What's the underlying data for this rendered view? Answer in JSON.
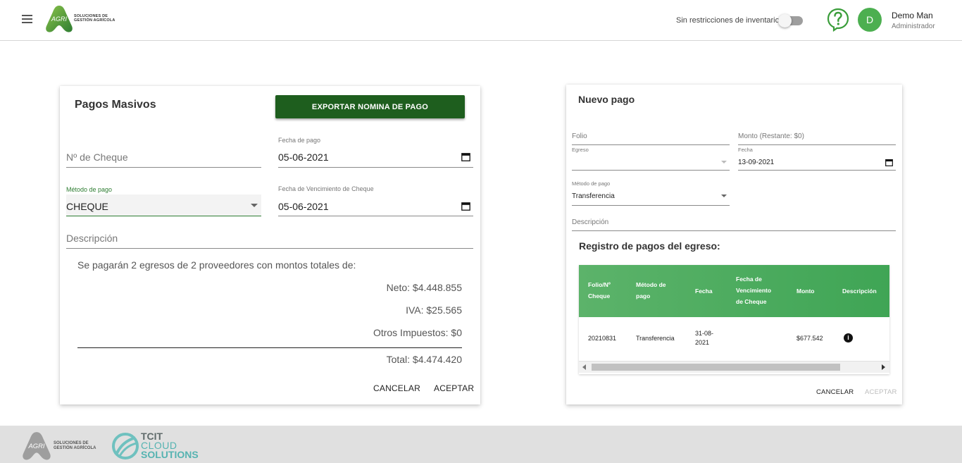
{
  "header": {
    "logo_text": "SOLUCIONES DE GESTIÓN AGRÍCOLA",
    "logo_mark": "AGRI",
    "inventory_label": "Sin restricciones de inventario",
    "user": {
      "initial": "D",
      "name": "Demo Man",
      "role": "Administrador"
    }
  },
  "left_card": {
    "title": "Pagos Masivos",
    "export_button": "EXPORTAR NOMINA DE PAGO",
    "cheque_placeholder": "Nº de Cheque",
    "fecha_pago_label": "Fecha de pago",
    "fecha_pago_value": "05-06-2021",
    "metodo_label": "Método de pago",
    "metodo_value": "CHEQUE",
    "vencimiento_label": "Fecha de Vencimiento de Cheque",
    "vencimiento_value": "05-06-2021",
    "descripcion_placeholder": "Descripción",
    "summary_text": "Se pagarán 2 egresos de 2 proveedores con montos totales de:",
    "neto": "Neto: $4.448.855",
    "iva": "IVA: $25.565",
    "otros": "Otros Impuestos: $0",
    "total": "Total: $4.474.420",
    "cancel": "CANCELAR",
    "accept": "ACEPTAR"
  },
  "right_card": {
    "title": "Nuevo pago",
    "folio_placeholder": "Folio",
    "monto_placeholder": "Monto (Restante: $0)",
    "egreso_label": "Egreso",
    "fecha_label": "Fecha",
    "fecha_value": "13-09-2021",
    "metodo_label": "Método de pago",
    "metodo_value": "Transferencia",
    "descripcion_placeholder": "Descripción",
    "registro_title": "Registro de pagos del egreso:",
    "table": {
      "headers": [
        "Folio/Nº Cheque",
        "Método de pago",
        "Fecha",
        "Fecha de Vencimiento de Cheque",
        "Monto",
        "Descripción"
      ],
      "rows": [
        {
          "folio": "20210831",
          "metodo": "Transferencia",
          "fecha": "31-08-2021",
          "vencimiento": "",
          "monto": "$677.542",
          "descripcion_icon": "info-icon"
        }
      ]
    },
    "cancel": "CANCELAR",
    "accept": "ACEPTAR"
  },
  "footer": {
    "logo_text": "SOLUCIONES DE GESTIÓN AGRÍCOLA",
    "logo_mark": "AGRI",
    "partner_line1": "TCIT",
    "partner_line2": "CLOUD",
    "partner_line3": "SOLUTIONS"
  },
  "colors": {
    "brand_green": "#1e5e1e",
    "accent_green": "#4caf50",
    "table_header": "#4caf5f",
    "active_underline": "#2e7d32"
  }
}
